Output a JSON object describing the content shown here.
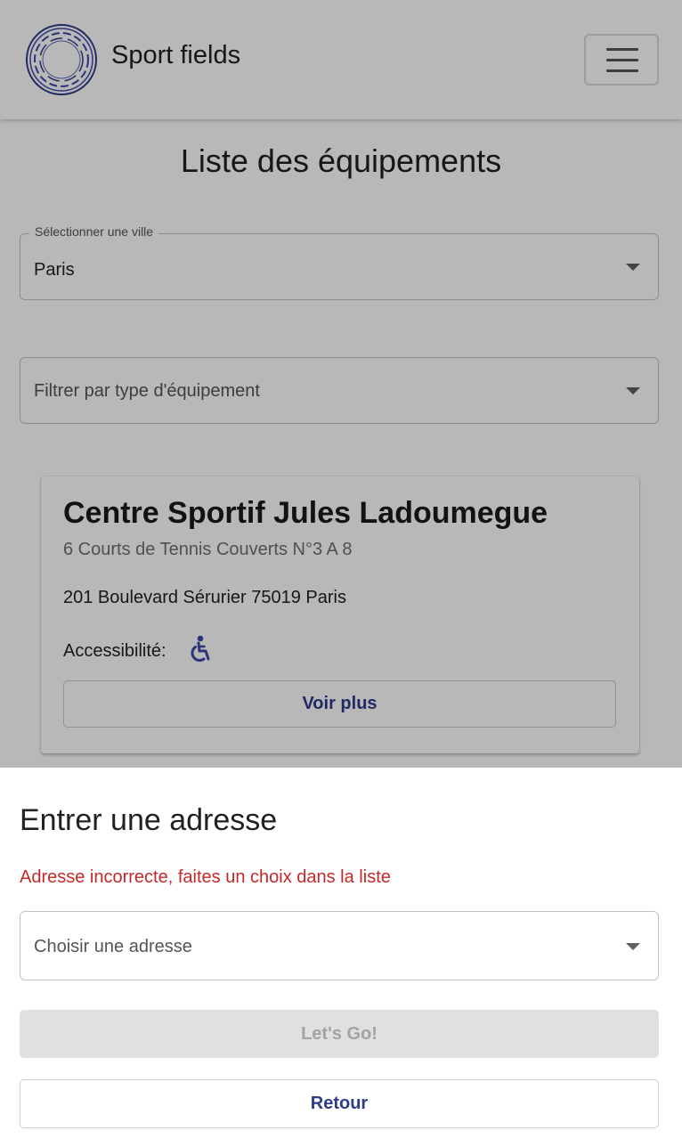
{
  "colors": {
    "primary": "#2f3b8a",
    "error": "#c62828",
    "disabled_bg": "#e0e0e0",
    "disabled_text": "#a3a3a3",
    "accessibility_icon": "#3949ab"
  },
  "header": {
    "title": "Sport fields",
    "logo_icon": "circle-logo-icon",
    "menu_icon": "hamburger-menu-icon"
  },
  "main": {
    "title": "Liste des équipements",
    "city_select": {
      "label": "Sélectionner une ville",
      "value": "Paris"
    },
    "type_filter": {
      "placeholder": "Filtrer par type d'équipement"
    },
    "card": {
      "title": "Centre Sportif Jules Ladoumegue",
      "subtitle": "6 Courts de Tennis Couverts N°3 A 8",
      "address": "201 Boulevard Sérurier 75019 Paris",
      "accessibility_label": "Accessibilité:",
      "accessibility_icon": "wheelchair-icon",
      "more_button": "Voir plus"
    }
  },
  "sheet": {
    "title": "Entrer une adresse",
    "error": "Adresse incorrecte, faites un choix dans la liste",
    "address_select": {
      "placeholder": "Choisir une adresse"
    },
    "submit_button": "Let's Go!",
    "back_button": "Retour"
  }
}
